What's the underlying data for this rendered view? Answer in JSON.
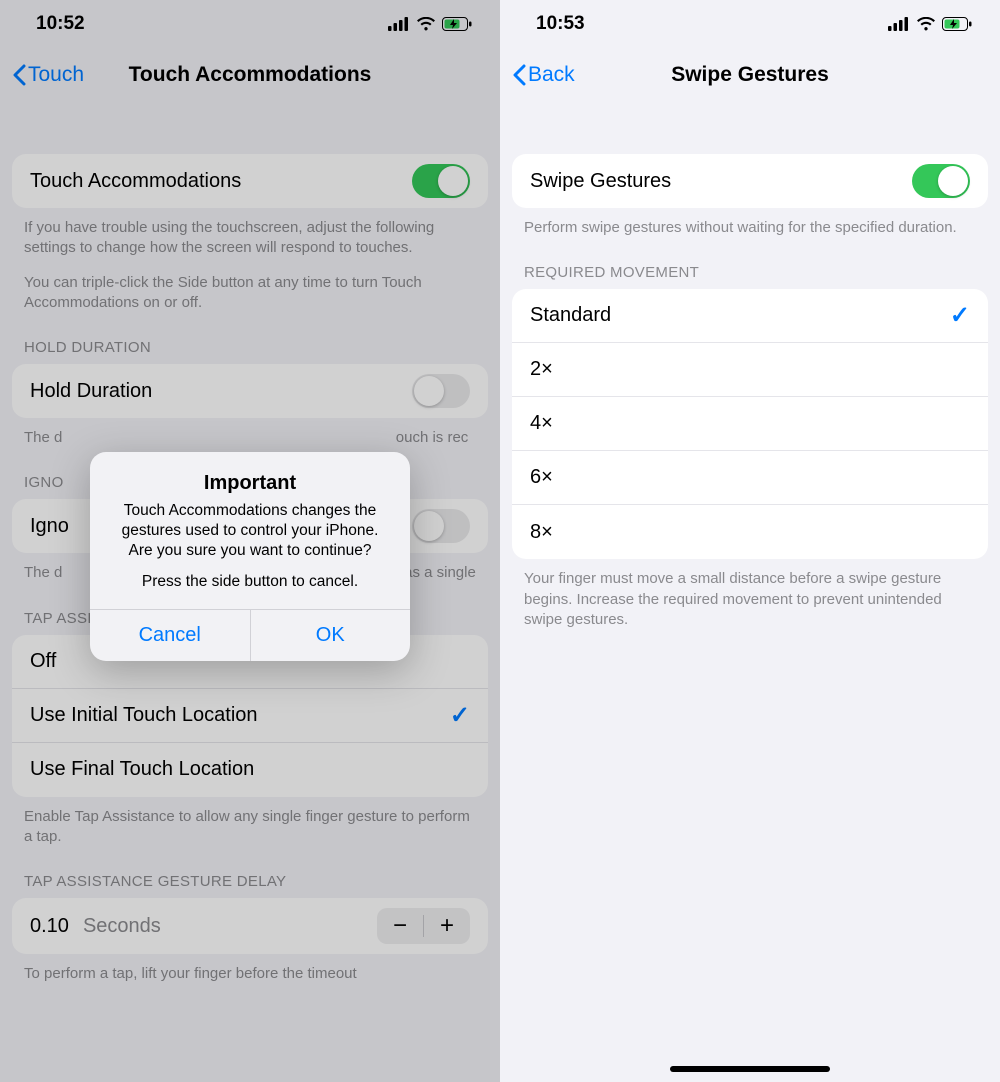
{
  "left": {
    "statusbar": {
      "time": "10:52"
    },
    "nav": {
      "back": "Touch",
      "title": "Touch Accommodations"
    },
    "master": {
      "label": "Touch Accommodations",
      "on": true,
      "footer1": "If you have trouble using the touchscreen, adjust the following settings to change how the screen will respond to touches.",
      "footer2": "You can triple-click the Side button at any time to turn Touch Accommodations on or off."
    },
    "hold": {
      "header": "HOLD DURATION",
      "label": "Hold Duration",
      "on": false,
      "footer": "The duration you must touch the screen before a touch is recognized."
    },
    "ignore": {
      "header_visible": "IGNO",
      "label_visible": "Igno",
      "on": false,
      "footer": "The duration in which multiple touches are treated as a single touch."
    },
    "tap": {
      "header": "TAP ASSISTANCE",
      "options": [
        "Off",
        "Use Initial Touch Location",
        "Use Final Touch Location"
      ],
      "selected_index": 1,
      "footer": "Enable Tap Assistance to allow any single finger gesture to perform a tap."
    },
    "delay": {
      "header": "TAP ASSISTANCE GESTURE DELAY",
      "value": "0.10",
      "unit": "Seconds",
      "footer_visible": "To perform a tap, lift your finger before the timeout"
    },
    "alert": {
      "title": "Important",
      "line1": "Touch Accommodations changes the gestures used to control your iPhone. Are you sure you want to continue?",
      "line2": "Press the side button to cancel.",
      "cancel": "Cancel",
      "ok": "OK"
    }
  },
  "right": {
    "statusbar": {
      "time": "10:53"
    },
    "nav": {
      "back": "Back",
      "title": "Swipe Gestures"
    },
    "master": {
      "label": "Swipe Gestures",
      "on": true,
      "footer": "Perform swipe gestures without waiting for the specified duration."
    },
    "movement": {
      "header": "REQUIRED MOVEMENT",
      "options": [
        "Standard",
        "2×",
        "4×",
        "6×",
        "8×"
      ],
      "selected_index": 0,
      "footer": "Your finger must move a small distance before a swipe gesture begins. Increase the required movement to prevent unintended swipe gestures."
    }
  }
}
